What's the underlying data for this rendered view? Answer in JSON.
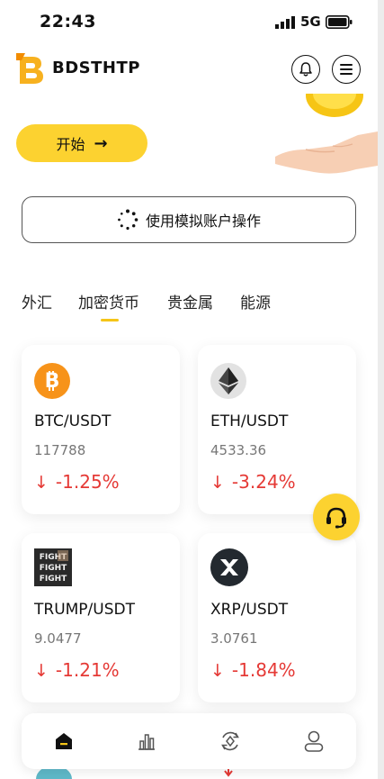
{
  "status_bar": {
    "time": "22:43",
    "network": "5G"
  },
  "header": {
    "brand": "BDSTHTP"
  },
  "hero": {
    "start_label": "开始",
    "start_arrow": "→"
  },
  "demo": {
    "label": "使用模拟账户操作"
  },
  "tabs": [
    {
      "label": "外汇"
    },
    {
      "label": "加密货币"
    },
    {
      "label": "贵金属"
    },
    {
      "label": "能源"
    }
  ],
  "active_tab": "加密货币",
  "markets": [
    {
      "pair": "BTC/USDT",
      "price": "117788",
      "change": "-1.25%",
      "icon": "bitcoin-icon"
    },
    {
      "pair": "ETH/USDT",
      "price": "4533.36",
      "change": "-3.24%",
      "icon": "ethereum-icon"
    },
    {
      "pair": "TRUMP/USDT",
      "price": "9.0477",
      "change": "-1.21%",
      "icon": "trump-token-icon"
    },
    {
      "pair": "XRP/USDT",
      "price": "3.0761",
      "change": "-1.84%",
      "icon": "xrp-icon"
    }
  ],
  "nav": [
    {
      "icon": "home-icon"
    },
    {
      "icon": "markets-chart-icon"
    },
    {
      "icon": "trade-exchange-icon"
    },
    {
      "icon": "profile-icon"
    }
  ],
  "colors": {
    "accent": "#fcd230",
    "negative": "#e53935"
  }
}
